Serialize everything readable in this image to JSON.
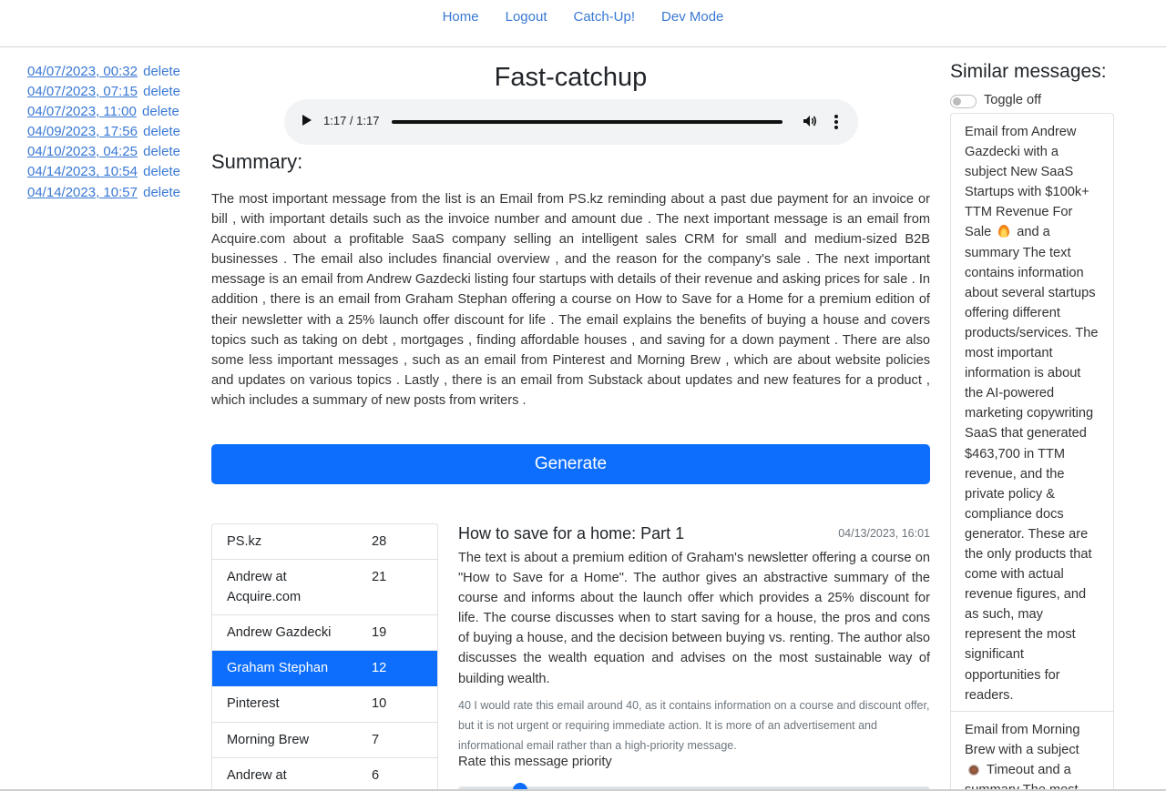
{
  "nav": {
    "items": [
      "Home",
      "Logout",
      "Catch-Up!",
      "Dev Mode"
    ]
  },
  "history": [
    {
      "date": "04/07/2023, 00:32",
      "action": "delete"
    },
    {
      "date": "04/07/2023, 07:15",
      "action": "delete"
    },
    {
      "date": "04/07/2023, 11:00",
      "action": "delete"
    },
    {
      "date": "04/09/2023, 17:56",
      "action": "delete"
    },
    {
      "date": "04/10/2023, 04:25",
      "action": "delete"
    },
    {
      "date": "04/14/2023, 10:54",
      "action": "delete"
    },
    {
      "date": "04/14/2023, 10:57",
      "action": "delete"
    }
  ],
  "main": {
    "title": "Fast-catchup",
    "audio": {
      "time": "1:17 / 1:17",
      "progress": 1.0
    },
    "summary_heading": "Summary:",
    "summary_text": "The most important message from the list is an Email from PS.kz reminding about a past due payment for an invoice or bill , with important details such as the invoice number and amount due . The next important message is an email from Acquire.com about a profitable SaaS company selling an intelligent sales CRM for small and medium-sized B2B businesses . The email also includes financial overview , and the reason for the company's sale . The next important message is an email from Andrew Gazdecki listing four startups with details of their revenue and asking prices for sale . In addition , there is an email from Graham Stephan offering a course on How to Save for a Home for a premium edition of their newsletter with a 25% launch offer discount for life . The email explains the benefits of buying a house and covers topics such as taking on debt , mortgages , finding affordable houses , and saving for a down payment . There are also some less important messages , such as an email from Pinterest and Morning Brew , which are about website policies and updates on various topics . Lastly , there is an email from Substack about updates and new features for a product , which includes a summary of new posts from writers .",
    "generate_label": "Generate"
  },
  "senders": [
    {
      "name": "PS.kz",
      "count": "28",
      "active": false
    },
    {
      "name": "Andrew at Acquire.com",
      "count": "21",
      "active": false
    },
    {
      "name": "Andrew Gazdecki",
      "count": "19",
      "active": false
    },
    {
      "name": "Graham Stephan",
      "count": "12",
      "active": true
    },
    {
      "name": "Pinterest",
      "count": "10",
      "active": false
    },
    {
      "name": "Morning Brew",
      "count": "7",
      "active": false
    },
    {
      "name": "Andrew at Acquire.com",
      "count": "6",
      "active": false
    }
  ],
  "message": {
    "subject": "How to save for a home: Part 1",
    "date": "04/13/2023, 16:01",
    "body": "The text is about a premium edition of Graham's newsletter offering a course on \"How to Save for a Home\". The author gives an abstractive summary of the course and informs about the launch offer which provides a 25% discount for life. The course discusses when to start saving for a house, the pros and cons of buying a house, and the decision between buying vs. renting. The author also discusses the wealth equation and advises on the most sustainable way of building wealth.",
    "rating_text": "40 I would rate this email around 40, as it contains information on a course and discount offer, but it is not urgent or requiring immediate action. It is more of an advertisement and informational email rather than a high-priority message.",
    "rate_label": "Rate this message priority",
    "priority_value": 0.12
  },
  "similar": {
    "heading": "Similar messages:",
    "toggle_label": "Toggle off",
    "items": [
      {
        "before_icon": "Email from Andrew Gazdecki with a subject New SaaS Startups with $100k+ TTM Revenue For Sale",
        "icon": "fire-emoji",
        "after_icon": "and a summary The text contains information about several startups offering different products/services. The most important information is about the AI-powered marketing copywriting SaaS that generated $463,700 in TTM revenue, and the private policy & compliance docs generator. These are the only products that come with actual revenue figures, and as such, may represent the most significant opportunities for readers."
      },
      {
        "before_icon": "Email from Morning Brew with a subject",
        "icon": "coffee-emoji",
        "after_icon": "Timeout and a summary The most important information"
      }
    ]
  }
}
